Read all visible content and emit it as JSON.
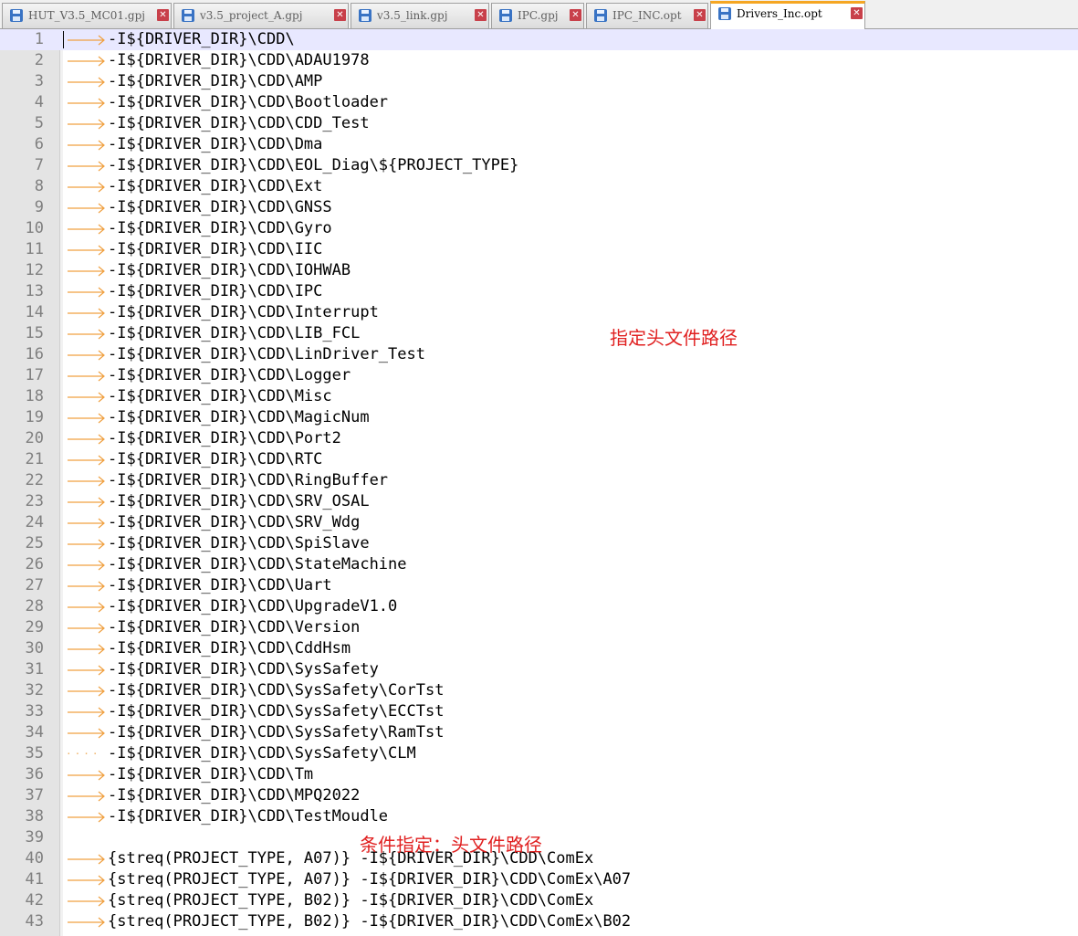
{
  "tabs": [
    {
      "label": "HUT_V3.5_MC01.gpj",
      "active": false
    },
    {
      "label": "v3.5_project_A.gpj",
      "active": false
    },
    {
      "label": "v3.5_link.gpj",
      "active": false
    },
    {
      "label": "IPC.gpj",
      "active": false
    },
    {
      "label": "IPC_INC.opt",
      "active": false
    },
    {
      "label": "Drivers_Inc.opt",
      "active": true
    }
  ],
  "tab_close_glyph": "✕",
  "accent_color": "#f5a623",
  "annotation_color": "#e02020",
  "annotations": {
    "include_paths": "指定头文件路径",
    "conditional_include_paths": "条件指定：头文件路径"
  },
  "lines": [
    {
      "num": "1",
      "lead": "tab",
      "text": "-I${DRIVER_DIR}\\CDD\\"
    },
    {
      "num": "2",
      "lead": "tab",
      "text": "-I${DRIVER_DIR}\\CDD\\ADAU1978"
    },
    {
      "num": "3",
      "lead": "tab",
      "text": "-I${DRIVER_DIR}\\CDD\\AMP"
    },
    {
      "num": "4",
      "lead": "tab",
      "text": "-I${DRIVER_DIR}\\CDD\\Bootloader"
    },
    {
      "num": "5",
      "lead": "tab",
      "text": "-I${DRIVER_DIR}\\CDD\\CDD_Test"
    },
    {
      "num": "6",
      "lead": "tab",
      "text": "-I${DRIVER_DIR}\\CDD\\Dma"
    },
    {
      "num": "7",
      "lead": "tab",
      "text": "-I${DRIVER_DIR}\\CDD\\EOL_Diag\\${PROJECT_TYPE}"
    },
    {
      "num": "8",
      "lead": "tab",
      "text": "-I${DRIVER_DIR}\\CDD\\Ext"
    },
    {
      "num": "9",
      "lead": "tab",
      "text": "-I${DRIVER_DIR}\\CDD\\GNSS"
    },
    {
      "num": "10",
      "lead": "tab",
      "text": "-I${DRIVER_DIR}\\CDD\\Gyro"
    },
    {
      "num": "11",
      "lead": "tab",
      "text": "-I${DRIVER_DIR}\\CDD\\IIC"
    },
    {
      "num": "12",
      "lead": "tab",
      "text": "-I${DRIVER_DIR}\\CDD\\IOHWAB"
    },
    {
      "num": "13",
      "lead": "tab",
      "text": "-I${DRIVER_DIR}\\CDD\\IPC"
    },
    {
      "num": "14",
      "lead": "tab",
      "text": "-I${DRIVER_DIR}\\CDD\\Interrupt"
    },
    {
      "num": "15",
      "lead": "tab",
      "text": "-I${DRIVER_DIR}\\CDD\\LIB_FCL"
    },
    {
      "num": "16",
      "lead": "tab",
      "text": "-I${DRIVER_DIR}\\CDD\\LinDriver_Test"
    },
    {
      "num": "17",
      "lead": "tab",
      "text": "-I${DRIVER_DIR}\\CDD\\Logger"
    },
    {
      "num": "18",
      "lead": "tab",
      "text": "-I${DRIVER_DIR}\\CDD\\Misc"
    },
    {
      "num": "19",
      "lead": "tab",
      "text": "-I${DRIVER_DIR}\\CDD\\MagicNum"
    },
    {
      "num": "20",
      "lead": "tab",
      "text": "-I${DRIVER_DIR}\\CDD\\Port2"
    },
    {
      "num": "21",
      "lead": "tab",
      "text": "-I${DRIVER_DIR}\\CDD\\RTC"
    },
    {
      "num": "22",
      "lead": "tab",
      "text": "-I${DRIVER_DIR}\\CDD\\RingBuffer"
    },
    {
      "num": "23",
      "lead": "tab",
      "text": "-I${DRIVER_DIR}\\CDD\\SRV_OSAL"
    },
    {
      "num": "24",
      "lead": "tab",
      "text": "-I${DRIVER_DIR}\\CDD\\SRV_Wdg"
    },
    {
      "num": "25",
      "lead": "tab",
      "text": "-I${DRIVER_DIR}\\CDD\\SpiSlave"
    },
    {
      "num": "26",
      "lead": "tab",
      "text": "-I${DRIVER_DIR}\\CDD\\StateMachine"
    },
    {
      "num": "27",
      "lead": "tab",
      "text": "-I${DRIVER_DIR}\\CDD\\Uart"
    },
    {
      "num": "28",
      "lead": "tab",
      "text": "-I${DRIVER_DIR}\\CDD\\UpgradeV1.0"
    },
    {
      "num": "29",
      "lead": "tab",
      "text": "-I${DRIVER_DIR}\\CDD\\Version"
    },
    {
      "num": "30",
      "lead": "tab",
      "text": "-I${DRIVER_DIR}\\CDD\\CddHsm"
    },
    {
      "num": "31",
      "lead": "tab",
      "text": "-I${DRIVER_DIR}\\CDD\\SysSafety"
    },
    {
      "num": "32",
      "lead": "tab",
      "text": "-I${DRIVER_DIR}\\CDD\\SysSafety\\CorTst"
    },
    {
      "num": "33",
      "lead": "tab",
      "text": "-I${DRIVER_DIR}\\CDD\\SysSafety\\ECCTst"
    },
    {
      "num": "34",
      "lead": "tab",
      "text": "-I${DRIVER_DIR}\\CDD\\SysSafety\\RamTst"
    },
    {
      "num": "35",
      "lead": "spaces",
      "text": "-I${DRIVER_DIR}\\CDD\\SysSafety\\CLM"
    },
    {
      "num": "36",
      "lead": "tab",
      "text": "-I${DRIVER_DIR}\\CDD\\Tm"
    },
    {
      "num": "37",
      "lead": "tab",
      "text": "-I${DRIVER_DIR}\\CDD\\MPQ2022"
    },
    {
      "num": "38",
      "lead": "tab",
      "text": "-I${DRIVER_DIR}\\CDD\\TestMoudle"
    },
    {
      "num": "39",
      "lead": "none",
      "text": ""
    },
    {
      "num": "40",
      "lead": "tab",
      "text": "{streq(PROJECT_TYPE, A07)} -I${DRIVER_DIR}\\CDD\\ComEx"
    },
    {
      "num": "41",
      "lead": "tab",
      "text": "{streq(PROJECT_TYPE, A07)} -I${DRIVER_DIR}\\CDD\\ComEx\\A07"
    },
    {
      "num": "42",
      "lead": "tab",
      "text": "{streq(PROJECT_TYPE, B02)} -I${DRIVER_DIR}\\CDD\\ComEx"
    },
    {
      "num": "43",
      "lead": "tab",
      "text": "{streq(PROJECT_TYPE, B02)} -I${DRIVER_DIR}\\CDD\\ComEx\\B02"
    }
  ]
}
